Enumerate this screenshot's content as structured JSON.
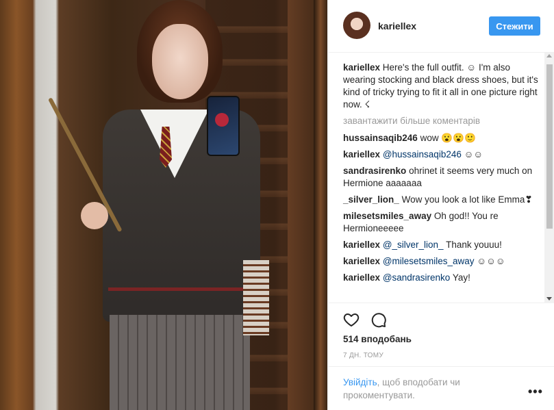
{
  "header": {
    "username": "kariellex",
    "follow_label": "Стежити"
  },
  "caption": {
    "user": "kariellex",
    "text": " Here's the full outfit. ☺ I'm also wearing stocking and black dress shoes, but it's kind of tricky trying to fit it all in one picture right now. ☇"
  },
  "load_more": "завантажити більше коментарів",
  "comments": [
    {
      "user": "hussainsaqib246",
      "mention": "",
      "text": " wow 😮😮🙂"
    },
    {
      "user": "kariellex",
      "mention": "@hussainsaqib246",
      "text": " ☺☺"
    },
    {
      "user": "sandrasirenko",
      "mention": "",
      "text": " ohrinet it seems very much on Hermione aaaaaaa"
    },
    {
      "user": "_silver_lion_",
      "mention": "",
      "text": " Wow you look a lot like Emma❣"
    },
    {
      "user": "milesetsmiles_away",
      "mention": "",
      "text": " Oh god!! You re Hermioneeeee"
    },
    {
      "user": "kariellex",
      "mention": "@_silver_lion_",
      "text": " Thank youuu!"
    },
    {
      "user": "kariellex",
      "mention": "@milesetsmiles_away",
      "text": " ☺☺☺"
    },
    {
      "user": "kariellex",
      "mention": "@sandrasirenko",
      "text": " Yay!"
    }
  ],
  "likes": "514 вподобань",
  "time": "7 ДН. ТОМУ",
  "footer": {
    "login_link": "Увійдіть",
    "login_text": ", щоб вподобати чи прокоментувати."
  },
  "icons": {
    "like": "heart-outline-icon",
    "comment": "speech-bubble-icon",
    "more": "ellipsis-icon"
  },
  "colors": {
    "accent": "#3897f0",
    "mention": "#003569",
    "muted": "#999999"
  }
}
